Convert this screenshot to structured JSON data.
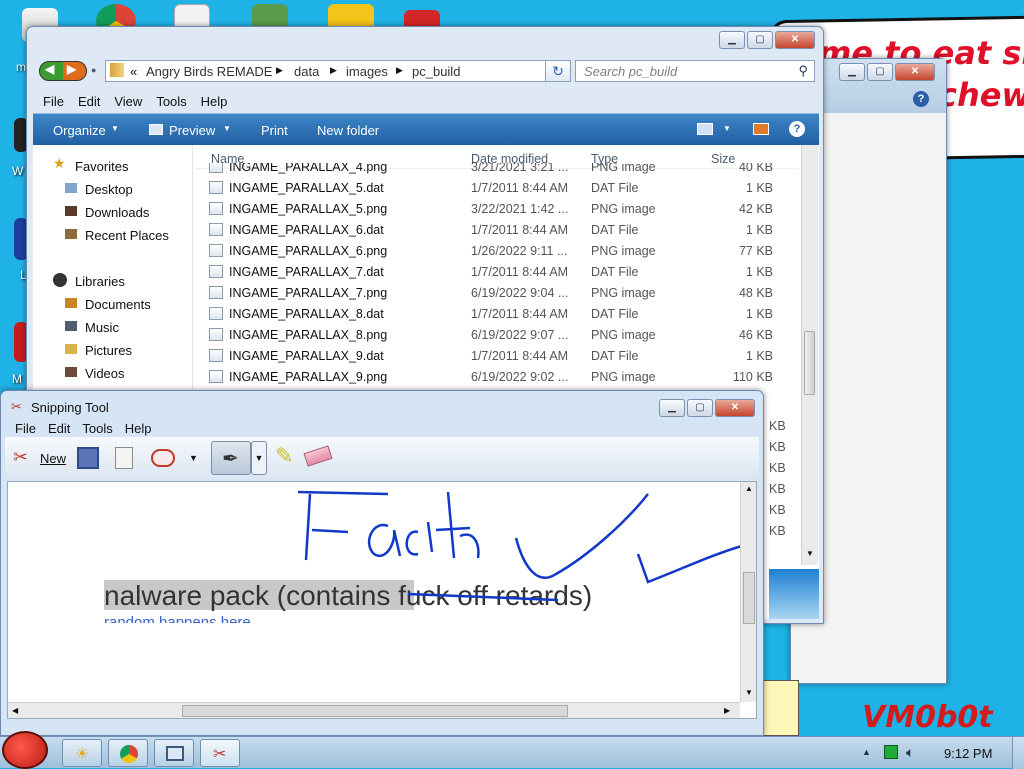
{
  "desktop": {
    "watermark": "VM0b0t",
    "sign_lines": [
      "me to eat shit",
      "chew"
    ],
    "icon_labels": [
      "m",
      "W",
      "L",
      "M"
    ]
  },
  "explorer": {
    "breadcrumb": {
      "prefix": "«",
      "parts": [
        "Angry Birds REMADE",
        "data",
        "images",
        "pc_build"
      ]
    },
    "search_placeholder": "Search pc_build",
    "menu": [
      "File",
      "Edit",
      "View",
      "Tools",
      "Help"
    ],
    "toolbar": {
      "organize": "Organize",
      "preview": "Preview",
      "print": "Print",
      "new_folder": "New folder"
    },
    "nav": {
      "favorites": "Favorites",
      "desktop": "Desktop",
      "downloads": "Downloads",
      "recent": "Recent Places",
      "libraries": "Libraries",
      "documents": "Documents",
      "music": "Music",
      "pictures": "Pictures",
      "videos": "Videos"
    },
    "columns": {
      "name": "Name",
      "date": "Date modified",
      "type": "Type",
      "size": "Size"
    },
    "files": [
      {
        "name": "INGAME_PARALLAX_4.png",
        "date": "3/21/2021 3:21 ...",
        "type": "PNG image",
        "size": "40 KB"
      },
      {
        "name": "INGAME_PARALLAX_5.dat",
        "date": "1/7/2011 8:44 AM",
        "type": "DAT File",
        "size": "1 KB"
      },
      {
        "name": "INGAME_PARALLAX_5.png",
        "date": "3/22/2021 1:42 ...",
        "type": "PNG image",
        "size": "42 KB"
      },
      {
        "name": "INGAME_PARALLAX_6.dat",
        "date": "1/7/2011 8:44 AM",
        "type": "DAT File",
        "size": "1 KB"
      },
      {
        "name": "INGAME_PARALLAX_6.png",
        "date": "1/26/2022 9:11 ...",
        "type": "PNG image",
        "size": "77 KB"
      },
      {
        "name": "INGAME_PARALLAX_7.dat",
        "date": "1/7/2011 8:44 AM",
        "type": "DAT File",
        "size": "1 KB"
      },
      {
        "name": "INGAME_PARALLAX_7.png",
        "date": "6/19/2022 9:04 ...",
        "type": "PNG image",
        "size": "48 KB"
      },
      {
        "name": "INGAME_PARALLAX_8.dat",
        "date": "1/7/2011 8:44 AM",
        "type": "DAT File",
        "size": "1 KB"
      },
      {
        "name": "INGAME_PARALLAX_8.png",
        "date": "6/19/2022 9:07 ...",
        "type": "PNG image",
        "size": "46 KB"
      },
      {
        "name": "INGAME_PARALLAX_9.dat",
        "date": "1/7/2011 8:44 AM",
        "type": "DAT File",
        "size": "1 KB"
      },
      {
        "name": "INGAME_PARALLAX_9.png",
        "date": "6/19/2022 9:02 ...",
        "type": "PNG image",
        "size": "110 KB"
      }
    ],
    "hidden_sizes": [
      "KB",
      "KB",
      "KB",
      "KB",
      "KB",
      "KB"
    ]
  },
  "snipping": {
    "title": "Snipping Tool",
    "menu": [
      "File",
      "Edit",
      "Tools",
      "Help"
    ],
    "new_label": "New",
    "captured_text": "nalware pack (contains fuck off retards)",
    "captured_link": "random happens here"
  },
  "taskbar": {
    "clock": "9:12 PM"
  },
  "colors": {
    "desktop": "#1fb2e6",
    "explorer_toolbar": "#2a6fb3",
    "ink": "#1238c9",
    "sign_text": "#e0102a"
  }
}
